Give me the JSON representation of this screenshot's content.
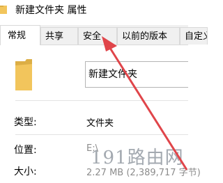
{
  "window": {
    "title": "新建文件夹 属性"
  },
  "tabs": [
    {
      "label": "常规",
      "active": true
    },
    {
      "label": "共享",
      "active": false
    },
    {
      "label": "安全",
      "active": false
    },
    {
      "label": "以前的版本",
      "active": false
    },
    {
      "label": "自定义",
      "active": false
    }
  ],
  "general": {
    "name_value": "新建文件夹",
    "type_label": "类型:",
    "type_value": "文件夹",
    "location_label": "位置:",
    "location_value": "E:\\",
    "size_label": "大小:",
    "size_value": "2.27 MB (2,389,717 字节)"
  },
  "watermark": "191路由网",
  "colors": {
    "arrow": "#e0454a",
    "folder": "#f2c55c",
    "folder_dark": "#dcae45"
  },
  "icons": {
    "title_icon": "folder-icon",
    "large_icon": "folder-icon",
    "annotation": "red-arrow-icon"
  }
}
